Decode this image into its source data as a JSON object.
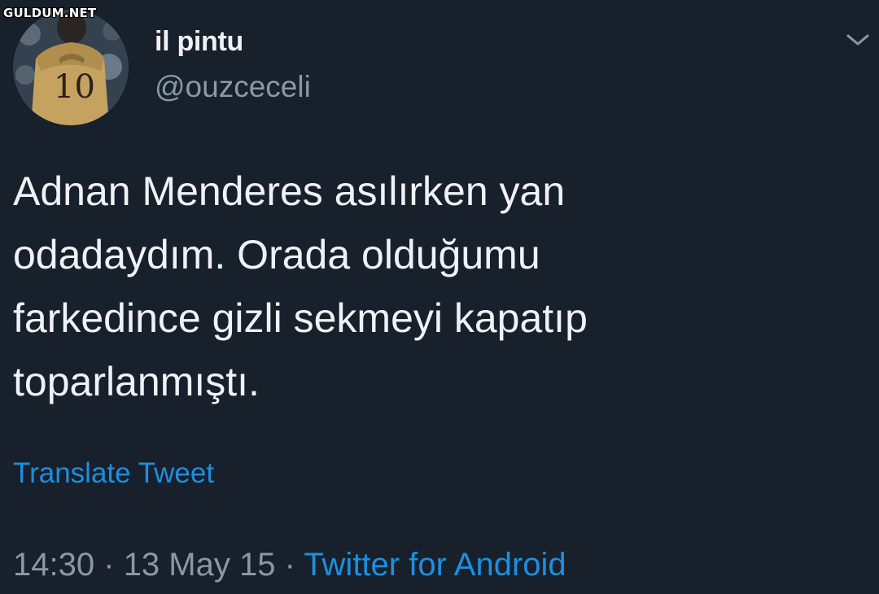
{
  "watermark": "GULDUM.NET",
  "tweet": {
    "author": {
      "display_name": "il pintu",
      "handle": "@ouzceceli",
      "avatar_icon": "avatar-photo"
    },
    "menu_icon": "chevron-down-icon",
    "text_lines": [
      "Adnan Menderes asılırken yan",
      "odadaydım. Orada olduğumu",
      "farkedince gizli sekmeyi kapatıp",
      "toparlanmıştı."
    ],
    "translate_label": "Translate Tweet",
    "time": "14:30",
    "separator": "·",
    "date": "13 May 15",
    "source": "Twitter for Android"
  },
  "colors": {
    "background": "#17202b",
    "text": "#eef2f5",
    "secondary": "#8899a6",
    "link": "#1d8fde"
  }
}
